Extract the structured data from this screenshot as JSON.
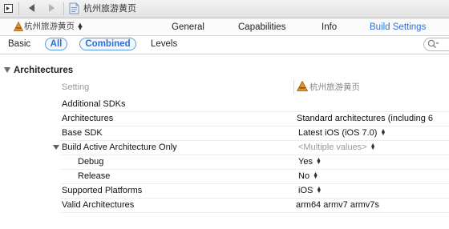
{
  "jumpbar": {
    "breadcrumb": "杭州旅游黄页"
  },
  "tabbar": {
    "target_name": "杭州旅游黄页",
    "tabs": [
      {
        "label": "General",
        "selected": false
      },
      {
        "label": "Capabilities",
        "selected": false
      },
      {
        "label": "Info",
        "selected": false
      },
      {
        "label": "Build Settings",
        "selected": true
      }
    ]
  },
  "filters": {
    "basic": "Basic",
    "all": "All",
    "combined": "Combined",
    "levels": "Levels"
  },
  "section": {
    "title": "Architectures",
    "column_setting": "Setting",
    "column_target": "杭州旅游黄页"
  },
  "rows": [
    {
      "label": "Additional SDKs",
      "value": ""
    },
    {
      "label": "Architectures",
      "value": "Standard architectures (including 6"
    },
    {
      "label": "Base SDK",
      "value": "Latest iOS (iOS 7.0)"
    },
    {
      "label": "Build Active Architecture Only",
      "value": "<Multiple values>"
    },
    {
      "label": "Debug",
      "value": "Yes"
    },
    {
      "label": "Release",
      "value": "No"
    },
    {
      "label": "Supported Platforms",
      "value": "iOS"
    },
    {
      "label": "Valid Architectures",
      "value": "arm64 armv7 armv7s"
    }
  ],
  "colors": {
    "accent": "#2f6fd6",
    "pill_border": "#5b9be8"
  }
}
